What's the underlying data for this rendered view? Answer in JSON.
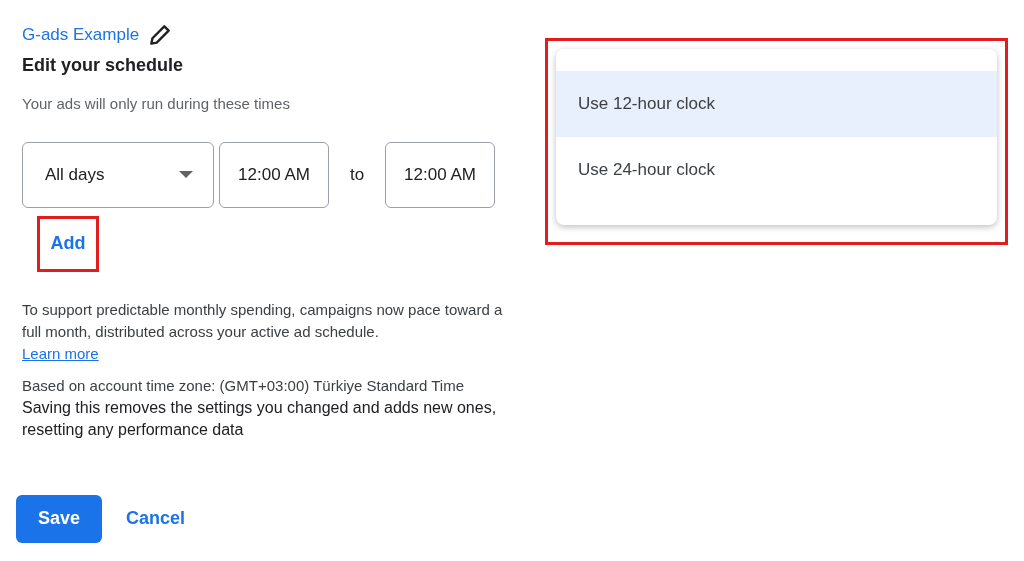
{
  "campaign": {
    "name": "G-ads Example"
  },
  "heading": "Edit your schedule",
  "subtitle": "Your ads will only run during these times",
  "schedule": {
    "days": "All days",
    "start": "12:00 AM",
    "separator": "to",
    "end": "12:00 AM"
  },
  "add_link": {
    "label": "Add",
    "highlighted": true
  },
  "notice": {
    "text": "To support predictable monthly spending, campaigns now pace toward a full month, distributed across your active ad schedule.",
    "link": "Learn more"
  },
  "timezone": "Based on account time zone: (GMT+03:00) Türkiye Standard Time",
  "warning": "Saving this removes the settings you changed and adds new ones, resetting any performance data",
  "buttons": [
    {
      "kind": "primary",
      "label": "Save"
    },
    {
      "kind": "text",
      "label": "Cancel"
    }
  ],
  "clock_menu": {
    "highlighted": true,
    "items": [
      {
        "label": "Use 12-hour clock",
        "selected": true
      },
      {
        "label": "Use 24-hour clock",
        "selected": false
      }
    ]
  }
}
